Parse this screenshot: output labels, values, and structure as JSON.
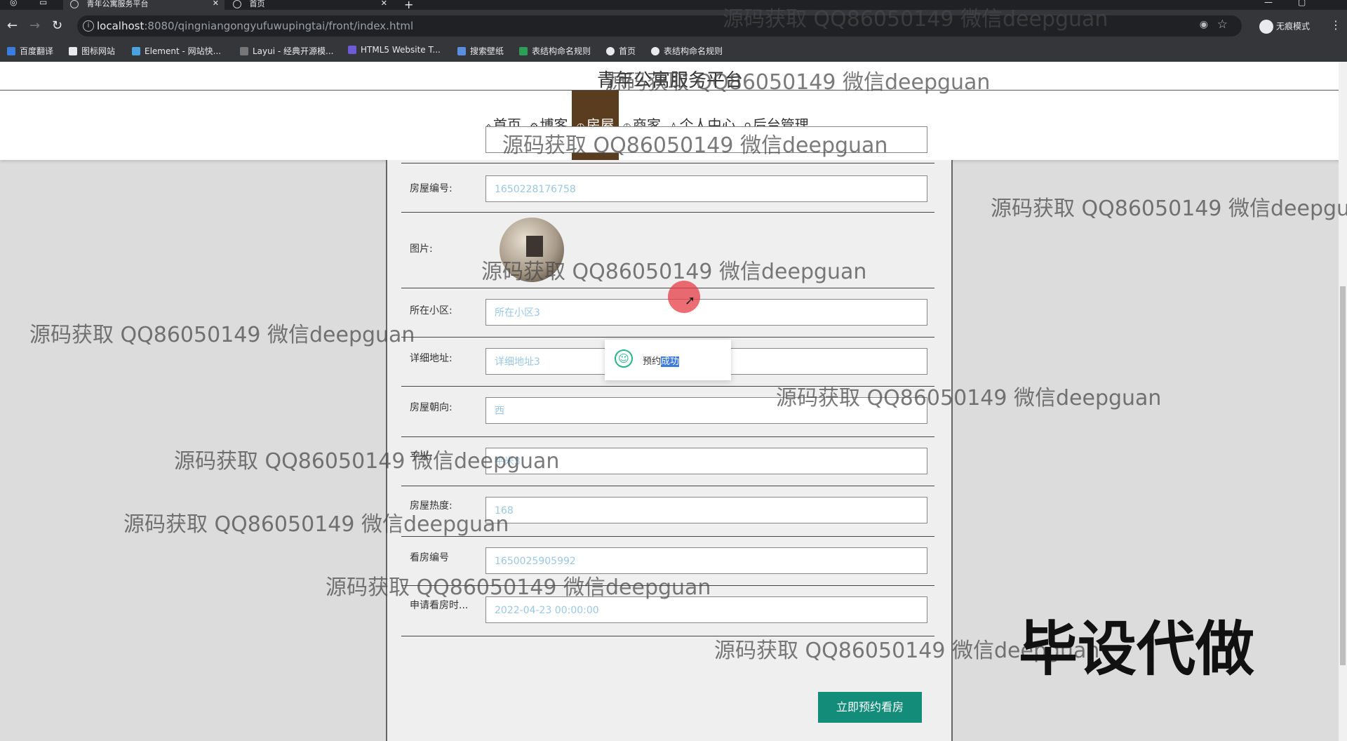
{
  "browser": {
    "tabs": [
      {
        "title": "青年公寓服务平台"
      },
      {
        "title": "首页"
      }
    ],
    "address": {
      "host": "localhost",
      "rest": ":8080/qingniangongyufuwupingtai/front/index.html"
    },
    "incognito_label": "无痕模式",
    "bookmarks": [
      "百度翻译",
      "图标网站",
      "Element - 网站快...",
      "Layui - 经典开源模...",
      "HTML5 Website T...",
      "搜索壁纸",
      "表结构命名规则",
      "首页",
      "表结构命名规则"
    ]
  },
  "site": {
    "title": "青年公寓服务平台"
  },
  "nav": [
    {
      "label": "首页",
      "icon": "home-icon"
    },
    {
      "label": "博客",
      "icon": "gear-icon"
    },
    {
      "label": "房屋",
      "icon": "clock-icon",
      "active": true
    },
    {
      "label": "商家",
      "icon": "clock-icon"
    },
    {
      "label": "个人中心",
      "icon": "user-icon"
    },
    {
      "label": "后台管理",
      "icon": "link-icon"
    }
  ],
  "form": {
    "rows": [
      {
        "label": "房屋编号:",
        "value": "1650228176758"
      },
      {
        "label": "图片:",
        "value": ""
      },
      {
        "label": "所在小区:",
        "value": "所在小区3"
      },
      {
        "label": "详细地址:",
        "value": "详细地址3"
      },
      {
        "label": "房屋朝向:",
        "value": "西"
      },
      {
        "label": "平米:",
        "value": "平米3"
      },
      {
        "label": "房屋热度:",
        "value": "168"
      },
      {
        "label": "看房编号",
        "value": "1650025905992"
      },
      {
        "label": "申请看房时...",
        "value": "2022-04-23 00:00:00"
      }
    ],
    "submit_label": "立即预约看房"
  },
  "toast": {
    "prefix": "预约",
    "selected": "成功"
  },
  "watermark": {
    "text": "源码获取 QQ86050149 微信deepguan",
    "big": "毕设代做"
  },
  "colors": {
    "nav_active": "#5a3c1f",
    "submit": "#138d7a",
    "toast_icon": "#28b487"
  }
}
